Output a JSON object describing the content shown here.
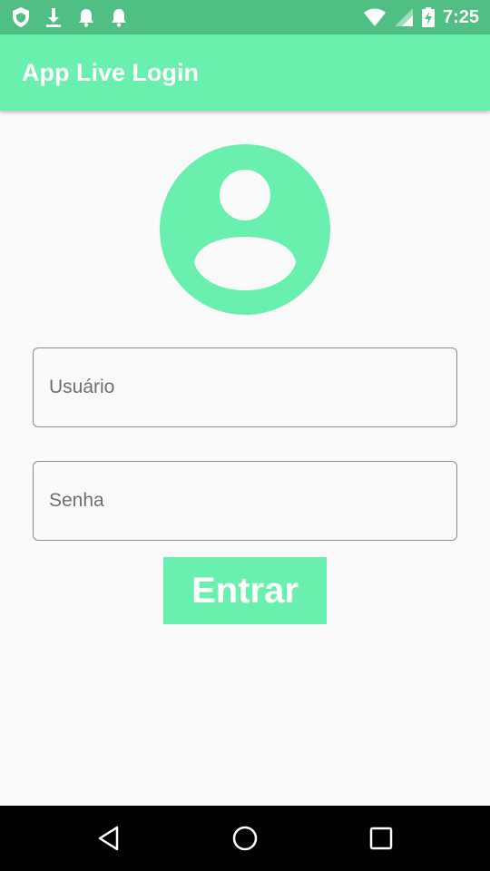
{
  "status_bar": {
    "time": "7:25",
    "left_icons": [
      "shield-icon",
      "download-icon",
      "bell-icon",
      "bell-icon"
    ],
    "right_icons": [
      "wifi-icon",
      "signal-icon",
      "battery-icon"
    ]
  },
  "app_bar": {
    "title": "App Live Login"
  },
  "avatar": {
    "icon": "account-circle-icon"
  },
  "form": {
    "username_placeholder": "Usuário",
    "password_placeholder": "Senha",
    "submit_label": "Entrar"
  },
  "nav_bar": {
    "icons": [
      "back-icon",
      "home-icon",
      "recents-icon"
    ]
  },
  "colors": {
    "accent": "#69f0ae",
    "status_bar": "#4fbf83",
    "background": "#fafafa",
    "nav_bar": "#000000"
  }
}
